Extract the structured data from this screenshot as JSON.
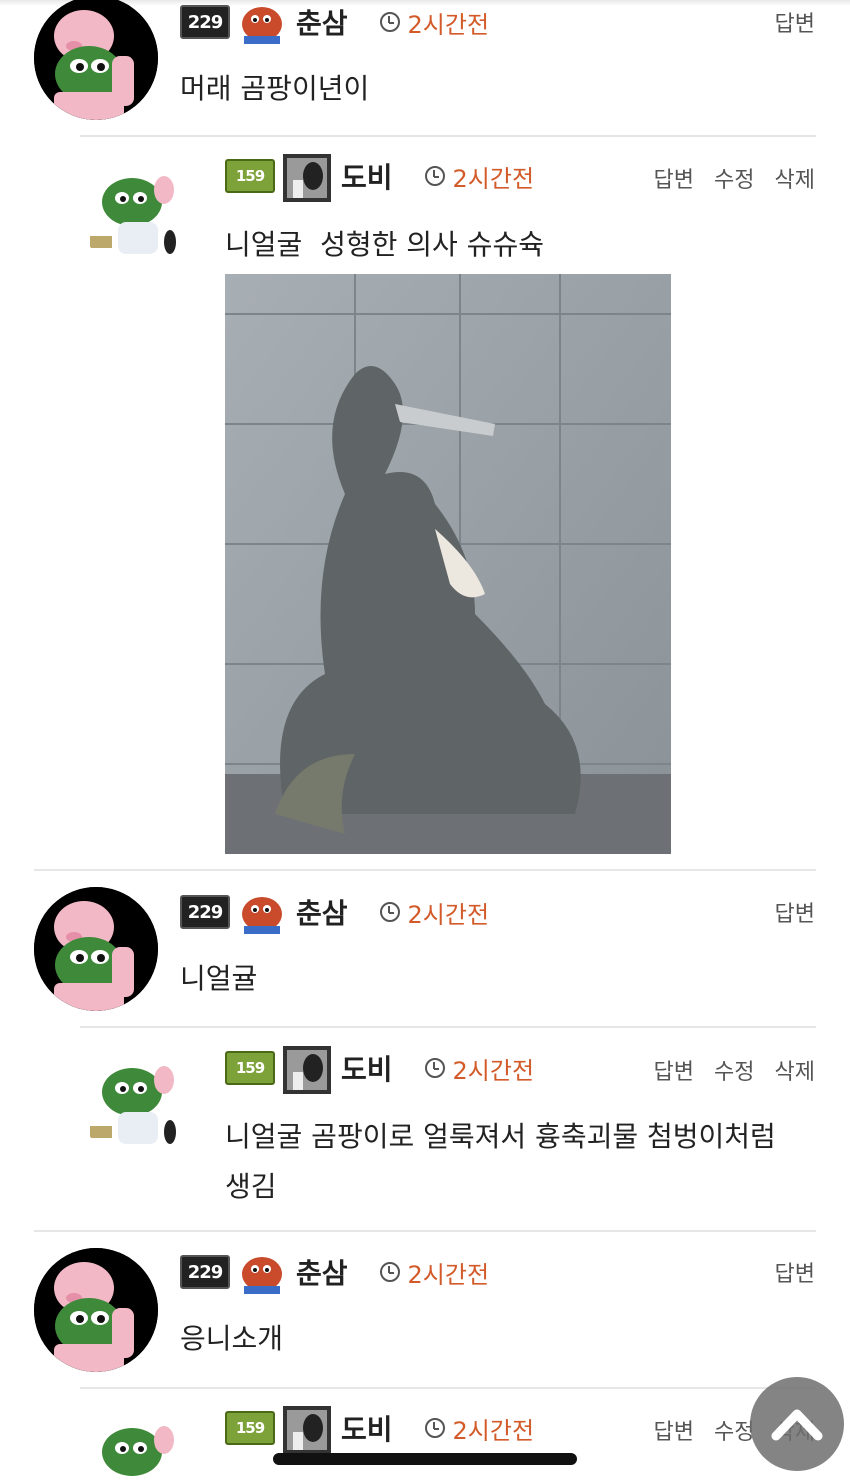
{
  "comments": [
    {
      "level": "229",
      "nickname": "춘삼",
      "time": "2시간전",
      "actions": [
        "답변"
      ],
      "text": "머래 곰팡이년이"
    },
    {
      "level": "159",
      "nickname": "도비",
      "time": "2시간전",
      "actions": [
        "답변",
        "수정",
        "삭제"
      ],
      "text": "니얼굴  성형한 의사 슈슈슉"
    },
    {
      "level": "229",
      "nickname": "춘삼",
      "time": "2시간전",
      "actions": [
        "답변"
      ],
      "text": "니얼귤"
    },
    {
      "level": "159",
      "nickname": "도비",
      "time": "2시간전",
      "actions": [
        "답변",
        "수정",
        "삭제"
      ],
      "text_line1": "니얼굴 곰팡이로 얼룩져서 흉축괴물 첨벙이처럼",
      "text_line2": "생김"
    },
    {
      "level": "229",
      "nickname": "춘삼",
      "time": "2시간전",
      "actions": [
        "답변"
      ],
      "text": "응니소개"
    },
    {
      "level": "159",
      "nickname": "도비",
      "time": "2시간전",
      "actions": [
        "답변",
        "수정",
        "삭제"
      ]
    }
  ],
  "colors": {
    "time": "#d35b2a",
    "text": "#222222",
    "action": "#555555",
    "divider": "#e6e6e6"
  },
  "icons": {
    "time": "clock-icon",
    "scroll_top": "chevron-up-icon"
  }
}
